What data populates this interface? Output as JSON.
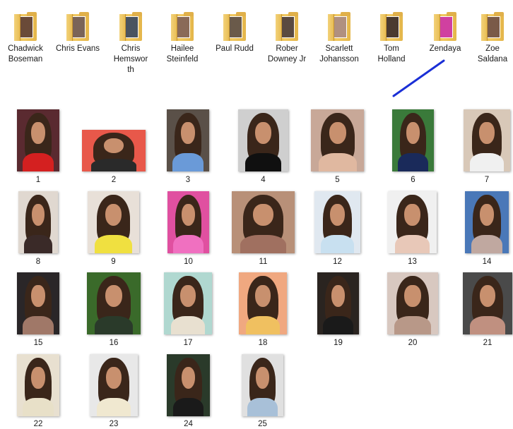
{
  "colors": {
    "folder": "#e8bb50",
    "pointer_line": "#1a2fd6",
    "skin": "#c8906e",
    "hair": "#3a261a"
  },
  "folders": [
    {
      "label": "Chadwick Boseman",
      "icon": "folder-icon",
      "accent": "#6a4a38"
    },
    {
      "label": "Chris Evans",
      "icon": "folder-icon",
      "accent": "#7a6458"
    },
    {
      "label": "Chris Hemsworth",
      "icon": "folder-icon",
      "accent": "#4a5460"
    },
    {
      "label": "Hailee Steinfeld",
      "icon": "folder-icon",
      "accent": "#8a6a58"
    },
    {
      "label": "Paul Rudd",
      "icon": "folder-icon",
      "accent": "#6a5a4a"
    },
    {
      "label": "Rober Downey Jr",
      "icon": "folder-icon",
      "accent": "#5a4a40"
    },
    {
      "label": "Scarlett Johansson",
      "icon": "folder-icon",
      "accent": "#b09080"
    },
    {
      "label": "Tom Holland",
      "icon": "folder-icon",
      "accent": "#4a3a30"
    },
    {
      "label": "Zendaya",
      "icon": "folder-icon",
      "accent": "#d040a0"
    },
    {
      "label": "Zoe Saldana",
      "icon": "folder-icon",
      "accent": "#7a5a48"
    }
  ],
  "images": [
    {
      "label": "1",
      "bg": "#5a2a30",
      "outfit": "#d42020"
    },
    {
      "label": "2",
      "bg": "#e8584a",
      "outfit": "#2a2a2a"
    },
    {
      "label": "3",
      "bg": "#5a5048",
      "outfit": "#6a9ad8"
    },
    {
      "label": "4",
      "bg": "#cfcfcf",
      "outfit": "#101010"
    },
    {
      "label": "5",
      "bg": "#c8a898",
      "outfit": "#e0b8a0"
    },
    {
      "label": "6",
      "bg": "#3a7a3a",
      "outfit": "#1a2a5a"
    },
    {
      "label": "7",
      "bg": "#d8c8b8",
      "outfit": "#f0f0f0"
    },
    {
      "label": "8",
      "bg": "#e0d8d0",
      "outfit": "#3a2a28"
    },
    {
      "label": "9",
      "bg": "#e8e0d8",
      "outfit": "#f0e040"
    },
    {
      "label": "10",
      "bg": "#e050a0",
      "outfit": "#f070c0"
    },
    {
      "label": "11",
      "bg": "#b89078",
      "outfit": "#a07060"
    },
    {
      "label": "12",
      "bg": "#e0e8f0",
      "outfit": "#c8e0f0"
    },
    {
      "label": "13",
      "bg": "#f0f0f0",
      "outfit": "#e8c8b8"
    },
    {
      "label": "14",
      "bg": "#4a78b8",
      "outfit": "#c0a8a0"
    },
    {
      "label": "15",
      "bg": "#2a2628",
      "outfit": "#a07868"
    },
    {
      "label": "16",
      "bg": "#3a6a2a",
      "outfit": "#2a3a2a"
    },
    {
      "label": "17",
      "bg": "#b0d8d0",
      "outfit": "#e8e0d0"
    },
    {
      "label": "18",
      "bg": "#f0a880",
      "outfit": "#f0c060"
    },
    {
      "label": "19",
      "bg": "#2a2420",
      "outfit": "#1a1a1a"
    },
    {
      "label": "20",
      "bg": "#d8c8c0",
      "outfit": "#b89888"
    },
    {
      "label": "21",
      "bg": "#4a4a4a",
      "outfit": "#c09080"
    },
    {
      "label": "22",
      "bg": "#e8e0d0",
      "outfit": "#e8e0c8"
    },
    {
      "label": "23",
      "bg": "#e8e8e8",
      "outfit": "#f0e8d0"
    },
    {
      "label": "24",
      "bg": "#2a3a2a",
      "outfit": "#1a1a1a"
    },
    {
      "label": "25",
      "bg": "#e0e0e0",
      "outfit": "#a8c0d8"
    }
  ]
}
